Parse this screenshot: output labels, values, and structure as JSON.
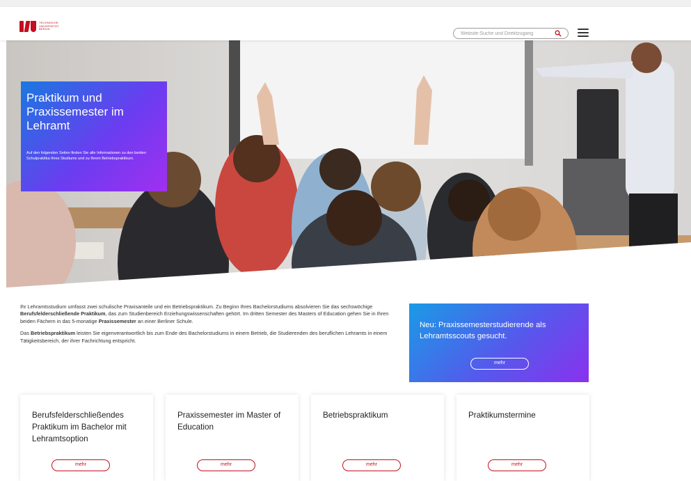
{
  "header": {
    "logo_lines": [
      "TECHNISCHE",
      "UNIVERSITÄT",
      "BERLIN"
    ],
    "search_placeholder": "Website-Suche und Direktzugang",
    "brand_color": "#c50e1f",
    "icons": {
      "search": "search-icon",
      "menu": "hamburger-menu-icon"
    }
  },
  "hero": {
    "title": "Praktikum und Praxissemester im Lehramt",
    "text": "Auf den folgenden Seiten finden Sie alle Informationen zu den beiden Schulpraktika Ihres Studiums und zu Ihrem Betriebspraktikum."
  },
  "intro": {
    "p1_a": "Ihr Lehramtsstudium umfasst zwei schulische Praxisanteile und ein Betriebspraktikum. Zu Beginn Ihres Bachelorstudiums absolvieren Sie das sechswöchige ",
    "p1_b": "Berufsfelderschließende Praktikum",
    "p1_c": ", das zum Studienbereich Erziehungswissenschaften gehört. Im dritten Semester des Masters of Education gehen Sie in Ihren beiden Fächern in das 5-monatige ",
    "p1_d": "Praxissemester",
    "p1_e": " an einer Berliner Schule.",
    "p2_a": "Das ",
    "p2_b": "Betriebspraktikum",
    "p2_c": " leisten Sie eigenverantwortlich bis zum Ende des Bachelorstudiums in einem Betrieb, die Studierenden des beruflichen Lehramts in einem Tätigkeitsbereich, der ihrer Fachrichtung entspricht."
  },
  "promo": {
    "text": "Neu: Praxissemesterstudierende als Lehramtsscouts gesucht.",
    "button": "mehr"
  },
  "cards": [
    {
      "title": "Berufsfelderschließendes Praktikum im Bachelor mit Lehramtsoption",
      "button": "mehr"
    },
    {
      "title": "Praxissemester im Master of Education",
      "button": "mehr"
    },
    {
      "title": "Betriebspraktikum",
      "button": "mehr"
    },
    {
      "title": "Praktikumstermine",
      "button": "mehr"
    }
  ]
}
